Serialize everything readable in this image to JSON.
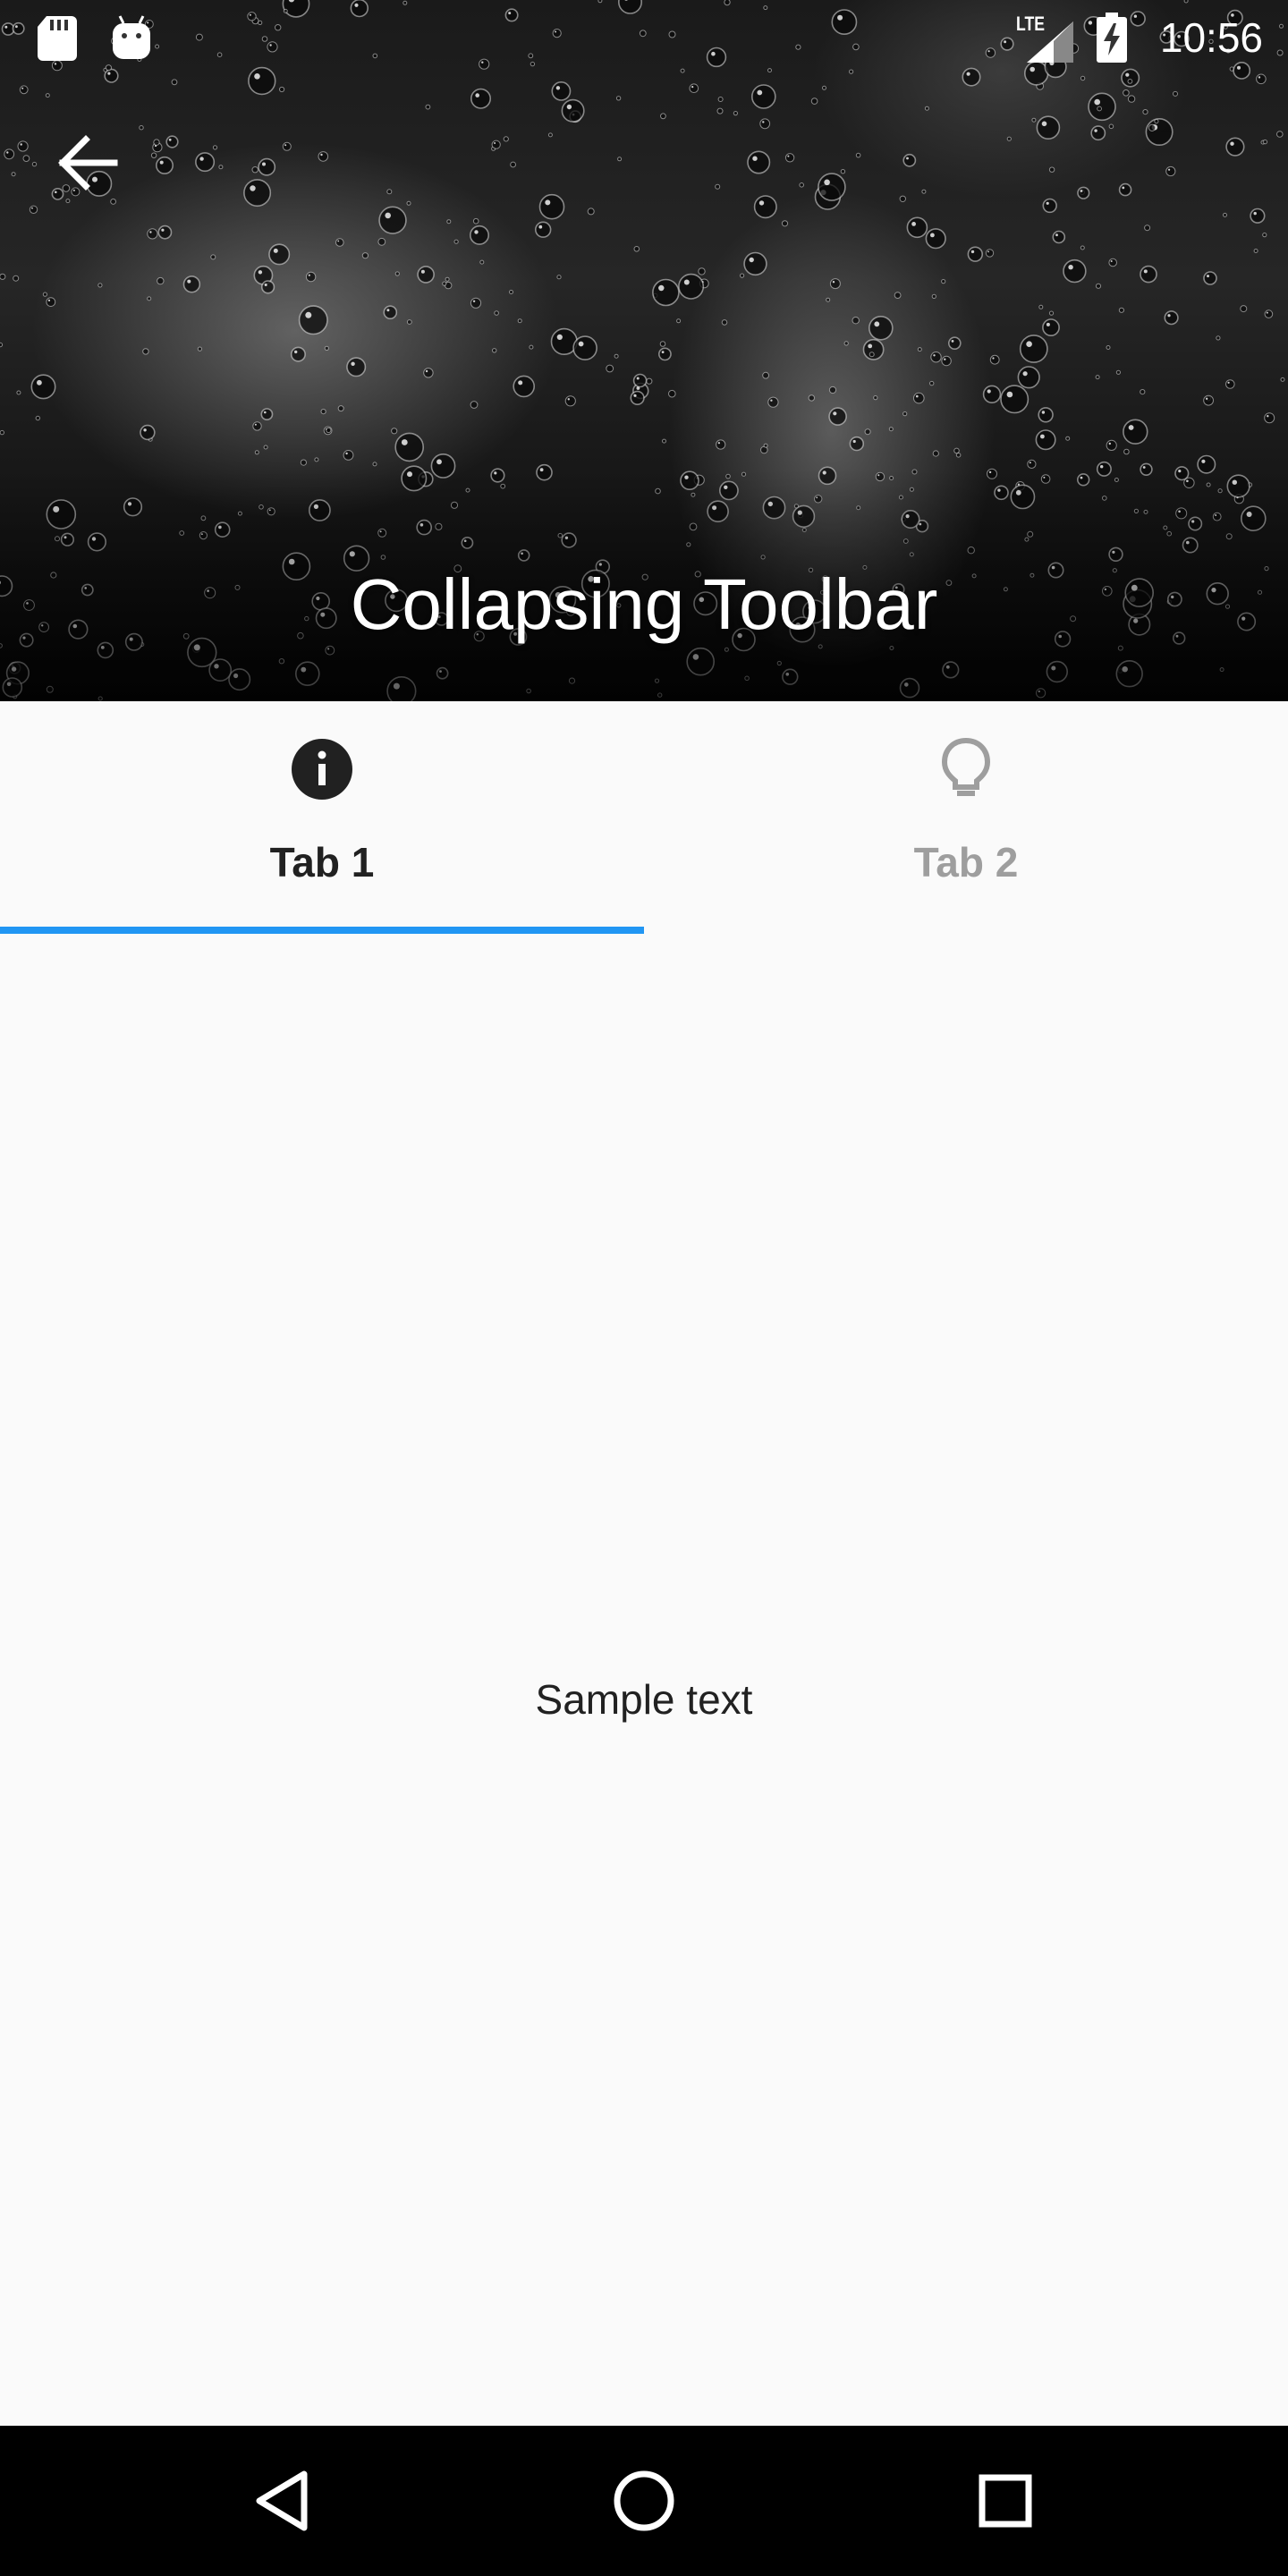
{
  "status_bar": {
    "time": "10:56",
    "network_label": "LTE",
    "icons": [
      "sd-card-icon",
      "android-icon",
      "lte-signal-icon",
      "battery-charging-icon"
    ]
  },
  "toolbar": {
    "title": "Collapsing Toolbar",
    "back_icon": "arrow-back-icon",
    "header_image": "raindrops-on-glass"
  },
  "tabs": [
    {
      "label": "Tab 1",
      "icon": "info-icon",
      "selected": true
    },
    {
      "label": "Tab 2",
      "icon": "lightbulb-icon",
      "selected": false
    }
  ],
  "content": {
    "text": "Sample text"
  },
  "colors": {
    "accent": "#2196f3",
    "tab_selected_text": "#212121",
    "tab_unselected_text": "#9e9e9e",
    "background": "#fafafa",
    "nav_bar": "#000000"
  },
  "nav_bar": {
    "buttons": [
      "back-triangle-icon",
      "home-circle-icon",
      "recents-square-icon"
    ]
  }
}
